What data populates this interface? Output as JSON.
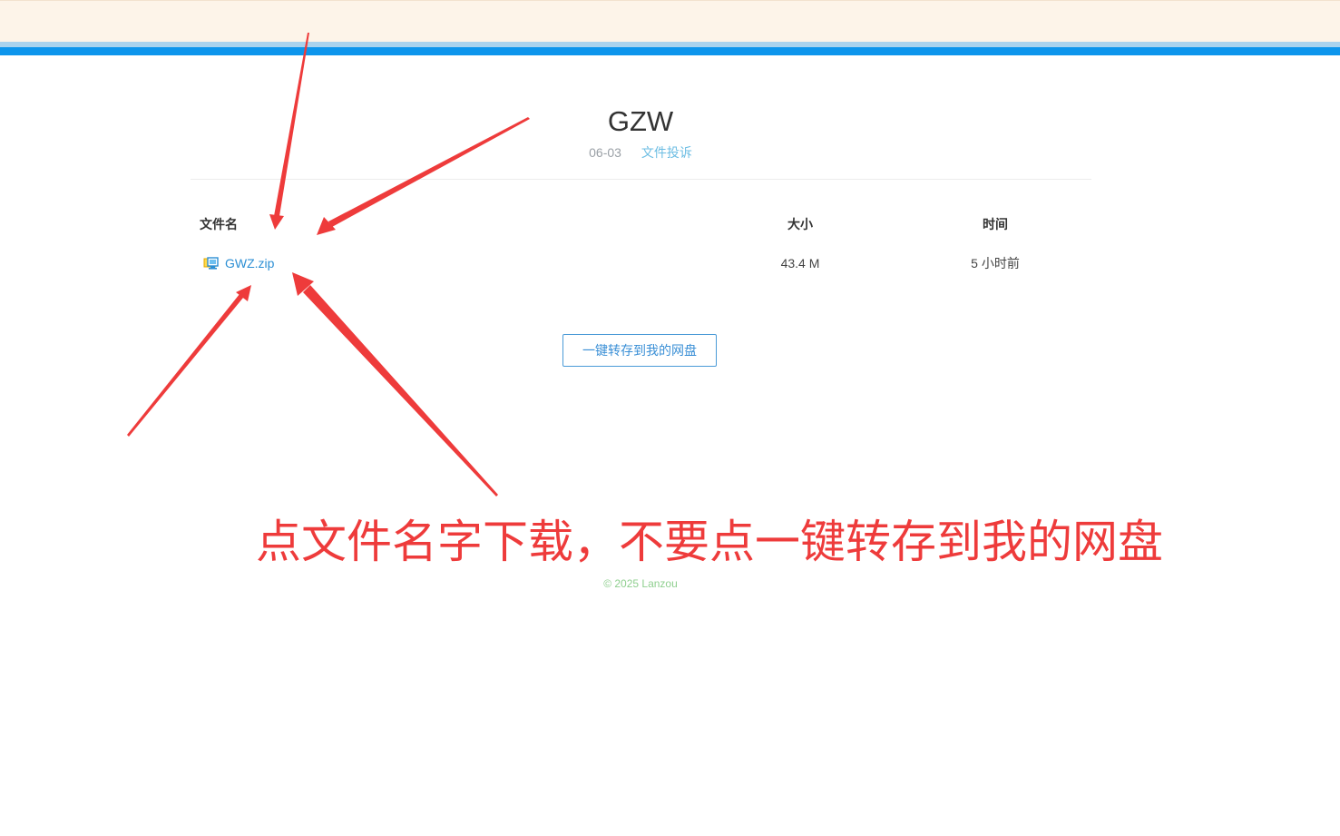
{
  "share": {
    "title": "GZW",
    "date": "06-03",
    "report_link": "文件投诉"
  },
  "table": {
    "headers": {
      "name": "文件名",
      "size": "大小",
      "time": "时间"
    },
    "files": [
      {
        "name": "GWZ.zip",
        "size": "43.4 M",
        "time": "5 小时前",
        "icon": "archive-file-icon"
      }
    ]
  },
  "actions": {
    "save_to_drive": "一键转存到我的网盘"
  },
  "annotation": {
    "text": "点文件名字下载，不要点一键转存到我的网盘",
    "color": "#ee3b3b"
  },
  "footer": {
    "copyright": "© 2025 Lanzou"
  },
  "colors": {
    "accent": "#0d95ec",
    "link": "#2c8fd4",
    "top_band": "#fdf4e9"
  }
}
